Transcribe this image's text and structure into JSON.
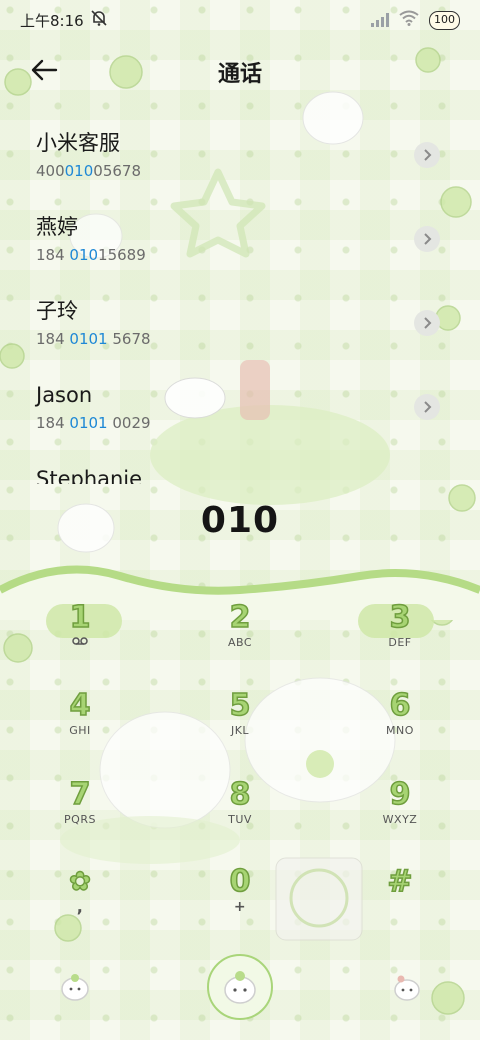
{
  "status_bar": {
    "time": "上午8:16",
    "battery": "100"
  },
  "header": {
    "title": "通话"
  },
  "contacts": [
    {
      "name": "小米客服",
      "number_pre": "400",
      "number_hl": "010",
      "number_post": "05678"
    },
    {
      "name": "燕婷",
      "number_pre": "184 ",
      "number_hl": "010",
      "number_post": "15689"
    },
    {
      "name": "子玲",
      "number_pre": "184 ",
      "number_hl": "0101",
      "number_post": " 5678"
    },
    {
      "name": "Jason",
      "number_pre": "184 ",
      "number_hl": "0101",
      "number_post": " 0029"
    },
    {
      "name": "Stephanie",
      "number_pre": "",
      "number_hl": "",
      "number_post": ""
    }
  ],
  "dialer": {
    "typed_number": "010"
  },
  "keypad": {
    "keys": [
      {
        "digit": "1",
        "sub": "voicemail-icon"
      },
      {
        "digit": "2",
        "sub": "ABC"
      },
      {
        "digit": "3",
        "sub": "DEF"
      },
      {
        "digit": "4",
        "sub": "GHI"
      },
      {
        "digit": "5",
        "sub": "JKL"
      },
      {
        "digit": "6",
        "sub": "MNO"
      },
      {
        "digit": "7",
        "sub": "PQRS"
      },
      {
        "digit": "8",
        "sub": "TUV"
      },
      {
        "digit": "9",
        "sub": "WXYZ"
      },
      {
        "digit": "✿",
        "sub": ","
      },
      {
        "digit": "0",
        "sub": "+"
      },
      {
        "digit": "#",
        "sub": ""
      }
    ]
  },
  "theme": {
    "accent_green": "#a7d473",
    "highlight_blue": "#1e88d6"
  }
}
